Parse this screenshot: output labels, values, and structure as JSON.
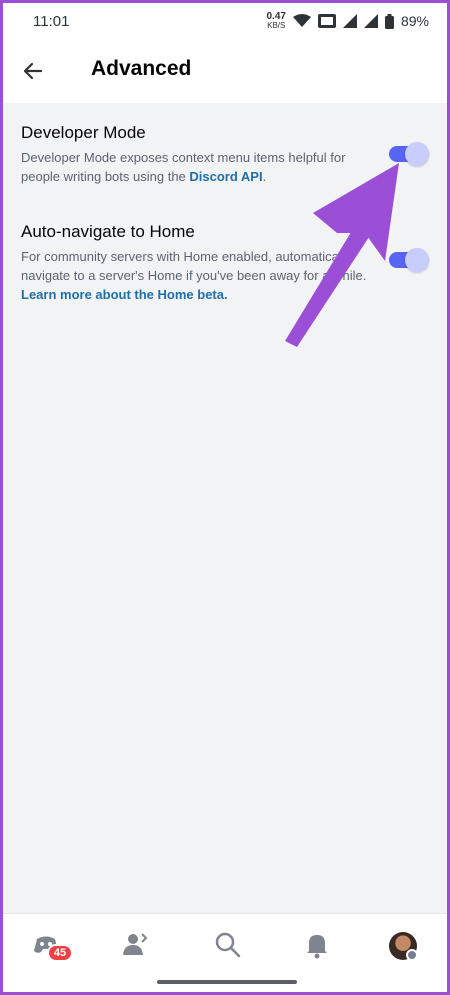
{
  "status_bar": {
    "time": "11:01",
    "net_speed": "0.47",
    "net_unit": "KB/S",
    "battery": "89%"
  },
  "header": {
    "title": "Advanced"
  },
  "settings": [
    {
      "title": "Developer Mode",
      "description": "Developer Mode exposes context menu items helpful for people writing bots using the ",
      "link": "Discord API",
      "suffix": ".",
      "enabled": true
    },
    {
      "title": "Auto-navigate to Home",
      "description": "For community servers with Home enabled, automatically navigate to a server's Home if you've been away for a while.",
      "link": "Learn more about the Home beta.",
      "enabled": true
    }
  ],
  "bottom_nav": {
    "badge_count": "45",
    "items": [
      "home-icon",
      "friends-icon",
      "search-icon",
      "notifications-icon",
      "avatar"
    ]
  },
  "colors": {
    "accent": "#5865f2",
    "annotation_arrow": "#9b4fd6",
    "link": "#1e6fa8",
    "badge": "#ed4245"
  }
}
